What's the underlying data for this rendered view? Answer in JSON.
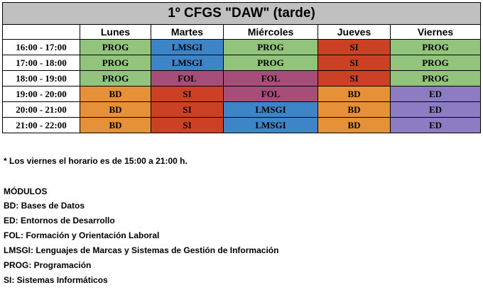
{
  "title": "1º CFGS \"DAW\" (tarde)",
  "days": [
    "Lunes",
    "Martes",
    "Miércoles",
    "Jueves",
    "Viernes"
  ],
  "colors": {
    "PROG": "#93c47d",
    "LMSGI": "#3d85c6",
    "SI": "#cc4125",
    "FOL": "#a64d79",
    "BD": "#e69138",
    "ED": "#8e7cc3"
  },
  "rows": [
    {
      "time": "16:00 - 17:00",
      "slots": [
        "PROG",
        "LMSGI",
        "PROG",
        "SI",
        "PROG"
      ]
    },
    {
      "time": "17:00 - 18:00",
      "slots": [
        "PROG",
        "LMSGI",
        "PROG",
        "SI",
        "PROG"
      ]
    },
    {
      "time": "18:00 - 19:00",
      "slots": [
        "PROG",
        "FOL",
        "FOL",
        "SI",
        "PROG"
      ]
    },
    {
      "time": "19:00 - 20:00",
      "slots": [
        "BD",
        "SI",
        "FOL",
        "BD",
        "ED"
      ]
    },
    {
      "time": "20:00 - 21:00",
      "slots": [
        "BD",
        "SI",
        "LMSGI",
        "BD",
        "ED"
      ]
    },
    {
      "time": "21:00 - 22:00",
      "slots": [
        "BD",
        "SI",
        "LMSGI",
        "BD",
        "ED"
      ]
    }
  ],
  "note": "* Los viernes el horario es de 15:00 a 21:00 h.",
  "modules_title": "MÓDULOS",
  "modules": [
    "BD: Bases de Datos",
    "ED: Entornos de Desarrollo",
    "FOL: Formación y Orientación Laboral",
    "LMSGI: Lenguajes de Marcas y Sistemas de Gestión de Información",
    "PROG: Programación",
    "SI: Sistemas Informáticos"
  ]
}
